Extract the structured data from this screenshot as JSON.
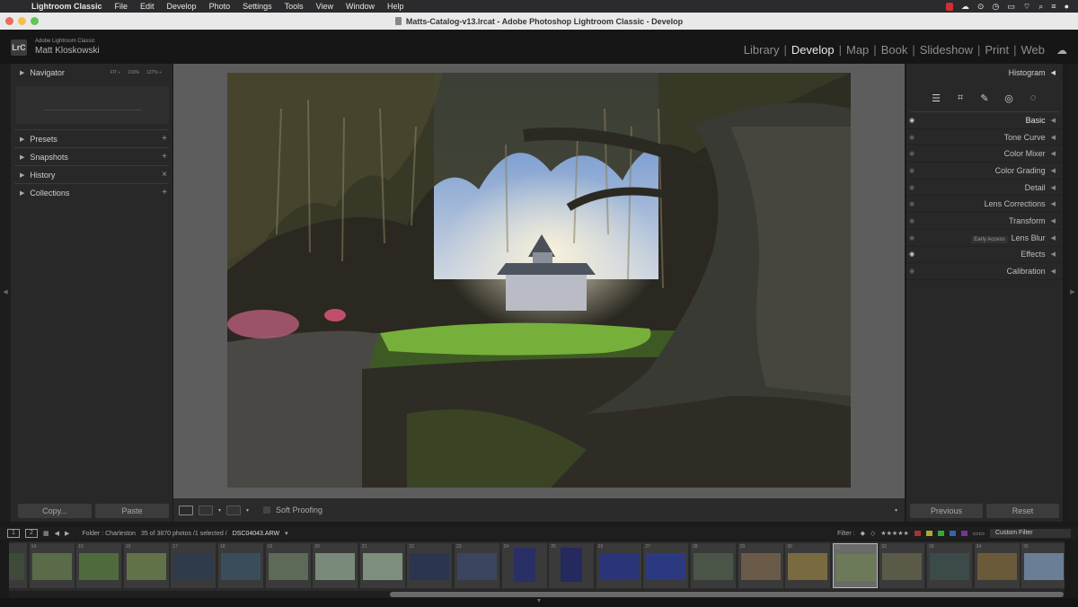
{
  "menubar": {
    "app": "Lightroom Classic",
    "items": [
      "File",
      "Edit",
      "Develop",
      "Photo",
      "Settings",
      "Tools",
      "View",
      "Window",
      "Help"
    ]
  },
  "window": {
    "title": "Matts-Catalog-v13.lrcat - Adobe Photoshop Lightroom Classic - Develop"
  },
  "identity": {
    "line1": "Adobe Lightroom Classic",
    "line2": "Matt Kloskowski",
    "logo": "LrC"
  },
  "modules": [
    {
      "label": "Library",
      "active": false
    },
    {
      "label": "Develop",
      "active": true
    },
    {
      "label": "Map",
      "active": false
    },
    {
      "label": "Book",
      "active": false
    },
    {
      "label": "Slideshow",
      "active": false
    },
    {
      "label": "Print",
      "active": false
    },
    {
      "label": "Web",
      "active": false
    }
  ],
  "left_panel": {
    "navigator": {
      "label": "Navigator",
      "zoom": [
        "FIT ÷",
        "100%",
        "127% ÷"
      ]
    },
    "sections": [
      {
        "label": "Presets",
        "action": "+"
      },
      {
        "label": "Snapshots",
        "action": "+"
      },
      {
        "label": "History",
        "action": "×"
      },
      {
        "label": "Collections",
        "action": "+"
      }
    ],
    "copy_label": "Copy...",
    "paste_label": "Paste"
  },
  "right_panel": {
    "histogram_label": "Histogram",
    "sections": [
      {
        "label": "Basic",
        "eye_on": true
      },
      {
        "label": "Tone Curve",
        "eye_on": false
      },
      {
        "label": "Color Mixer",
        "eye_on": false
      },
      {
        "label": "Color Grading",
        "eye_on": false
      },
      {
        "label": "Detail",
        "eye_on": false
      },
      {
        "label": "Lens Corrections",
        "eye_on": false
      },
      {
        "label": "Transform",
        "eye_on": false
      },
      {
        "label": "Lens Blur",
        "eye_on": false,
        "badge": "Early Access"
      },
      {
        "label": "Effects",
        "eye_on": true
      },
      {
        "label": "Calibration",
        "eye_on": false
      }
    ],
    "previous_label": "Previous",
    "reset_label": "Reset"
  },
  "toolbar": {
    "soft_proofing_label": "Soft Proofing"
  },
  "filmstrip": {
    "page1": "1",
    "page2": "2",
    "folder": "Folder : Charleston",
    "count": "35 of 3870 photos /1 selected /",
    "filename": "DSC04043.ARW",
    "filter_label": "Filter :",
    "custom_filter": "Custom Filter",
    "selected_index": 18,
    "thumbs": [
      {
        "n": "",
        "c": "#3e4a3a",
        "tall": false
      },
      {
        "n": "14",
        "c": "#5a6b4a",
        "tall": false
      },
      {
        "n": "15",
        "c": "#4f6a3c",
        "tall": false
      },
      {
        "n": "16",
        "c": "#627248",
        "tall": false
      },
      {
        "n": "17",
        "c": "#2f3a4a",
        "tall": false
      },
      {
        "n": "18",
        "c": "#3a4d5a",
        "tall": false
      },
      {
        "n": "19",
        "c": "#5d6a58",
        "tall": false
      },
      {
        "n": "20",
        "c": "#7a8a7a",
        "tall": false
      },
      {
        "n": "21",
        "c": "#7d8f7c",
        "tall": false
      },
      {
        "n": "22",
        "c": "#2b3550",
        "tall": false
      },
      {
        "n": "23",
        "c": "#3b4560",
        "tall": false
      },
      {
        "n": "24",
        "c": "#2a2f66",
        "tall": true
      },
      {
        "n": "25",
        "c": "#242a5e",
        "tall": true
      },
      {
        "n": "26",
        "c": "#2a3478",
        "tall": false
      },
      {
        "n": "27",
        "c": "#2b3a80",
        "tall": false
      },
      {
        "n": "28",
        "c": "#4a5548",
        "tall": false
      },
      {
        "n": "29",
        "c": "#6a5a48",
        "tall": false
      },
      {
        "n": "30",
        "c": "#7a6a40",
        "tall": false
      },
      {
        "n": "31",
        "c": "#6d7a5a",
        "tall": false
      },
      {
        "n": "32",
        "c": "#5b5a48",
        "tall": false
      },
      {
        "n": "33",
        "c": "#3c4a4a",
        "tall": false
      },
      {
        "n": "34",
        "c": "#6a5a3a",
        "tall": false
      },
      {
        "n": "35",
        "c": "#6a7e96",
        "tall": false
      }
    ]
  }
}
